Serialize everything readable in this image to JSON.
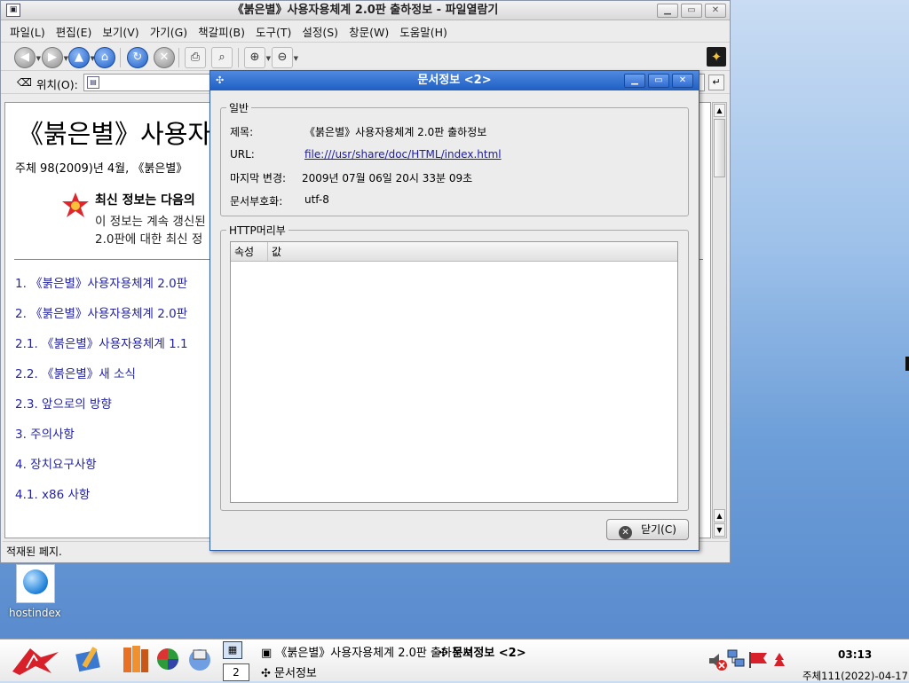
{
  "browser": {
    "title": "《붉은별》사용자용체계 2.0판 출하정보 - 파일열람기",
    "menu": [
      "파일(L)",
      "편집(E)",
      "보기(V)",
      "가기(G)",
      "책갈피(B)",
      "도구(T)",
      "설정(S)",
      "창문(W)",
      "도움말(H)"
    ],
    "location_label": "위치(O):",
    "location_value": "",
    "page": {
      "heading": "《붉은별》사용자",
      "intro": "주체 98(2009)년 4월, 《붉은별》",
      "news_title": "최신 정보는 다음의",
      "news_line1": "이 정보는 계속 갱신된",
      "news_line2": "2.0판에 대한 최신 정",
      "links": [
        "1. 《붉은별》사용자용체계 2.0판",
        "2. 《붉은별》사용자용체계 2.0판",
        "2.1. 《붉은별》사용자용체계 1.1",
        "2.2. 《붉은별》새 소식",
        "2.3. 앞으로의 방향",
        "3. 주의사항",
        "4. 장치요구사항",
        "4.1. x86 사항"
      ]
    },
    "status": "적재된 페지."
  },
  "dialog": {
    "title": "문서정보 <2>",
    "general": {
      "group_label": "일반",
      "title_label": "제목:",
      "title_value": "《붉은별》사용자용체계 2.0판 출하정보",
      "url_label": "URL:",
      "url_value": "file:///usr/share/doc/HTML/index.html",
      "modified_label": "마지막 변경:",
      "modified_value": "2009년 07월 06일 20시 33분 09초",
      "encoding_label": "문서부호화:",
      "encoding_value": "utf-8"
    },
    "http": {
      "group_label": "HTTP머리부",
      "columns": [
        "속성",
        "값"
      ],
      "rows": []
    },
    "close_label": "닫기(C)"
  },
  "desktop": {
    "icon_label": "hostindex"
  },
  "taskbar": {
    "task_browser": "《붉은별》사용자용체계 2.0판 출하정보",
    "task_dialog": "문서정보 <2>",
    "task_info": "문서정보",
    "workspace": "2",
    "clock": "03:13",
    "date": "주체111(2022)-04-17"
  },
  "colors": {
    "dialog_title": "#2f6ad0",
    "link": "#2424a0",
    "desktop": "#6d9ed8"
  }
}
